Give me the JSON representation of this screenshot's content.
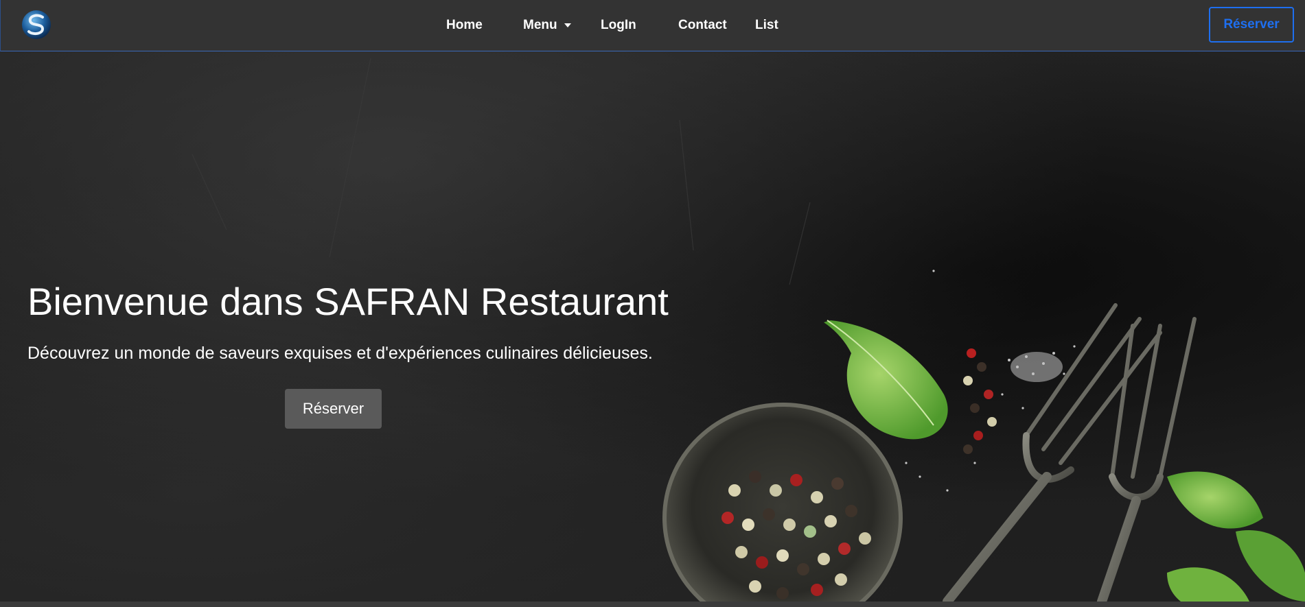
{
  "navbar": {
    "logo_icon": "safran-logo-icon",
    "links": {
      "home": "Home",
      "menu": "Menu",
      "login": "LogIn",
      "contact": "Contact",
      "list": "List"
    },
    "reserve_label": "Réserver"
  },
  "hero": {
    "title": "Bienvenue dans SAFRAN Restaurant",
    "subtitle": "Découvrez un monde de saveurs exquises et d'expériences culinaires délicieuses.",
    "button_label": "Réserver"
  },
  "colors": {
    "navbar_bg": "#333333",
    "accent": "#1e6ff0",
    "hero_button_bg": "#5a5a5a"
  }
}
